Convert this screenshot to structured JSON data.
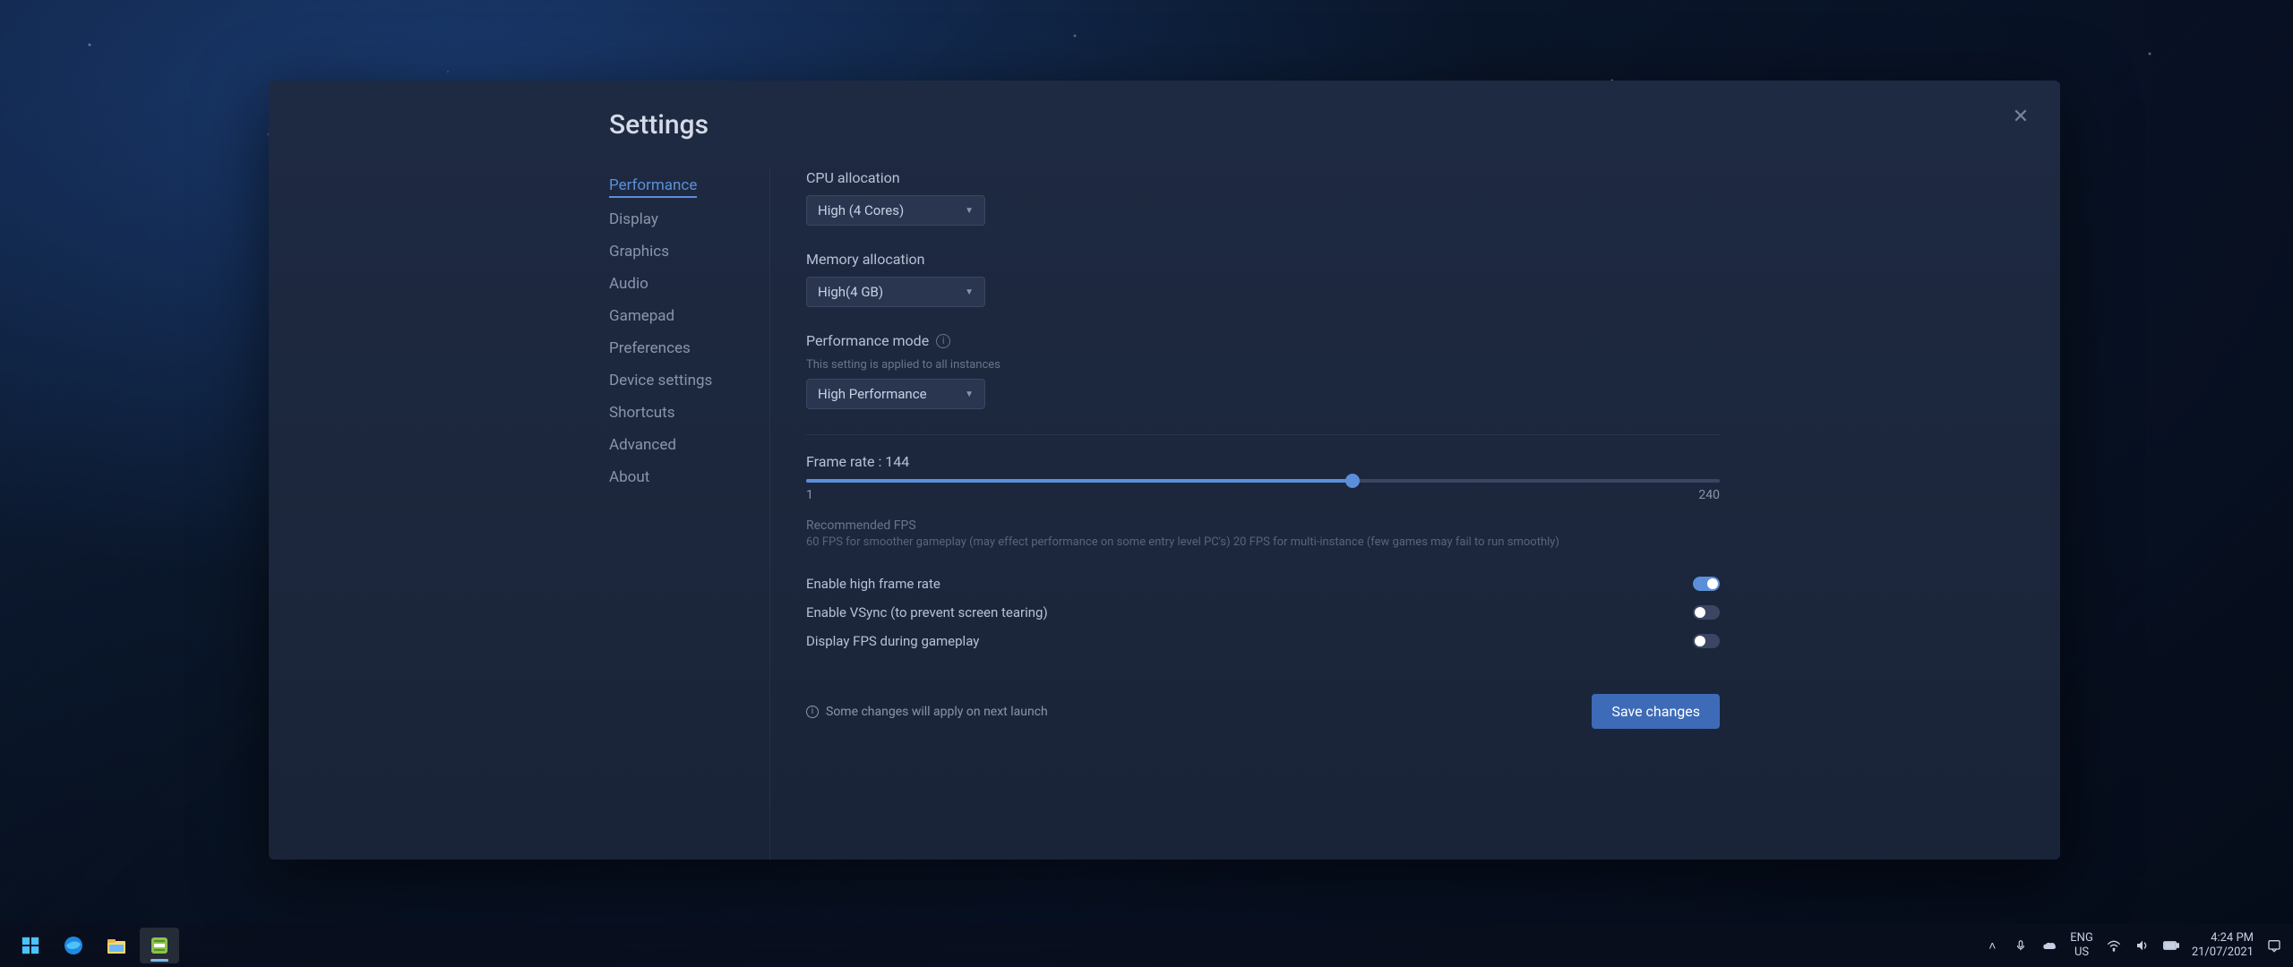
{
  "modal": {
    "title": "Settings",
    "close_label": "✕"
  },
  "sidebar": {
    "items": [
      {
        "label": "Performance",
        "active": true
      },
      {
        "label": "Display",
        "active": false
      },
      {
        "label": "Graphics",
        "active": false
      },
      {
        "label": "Audio",
        "active": false
      },
      {
        "label": "Gamepad",
        "active": false
      },
      {
        "label": "Preferences",
        "active": false
      },
      {
        "label": "Device settings",
        "active": false
      },
      {
        "label": "Shortcuts",
        "active": false
      },
      {
        "label": "Advanced",
        "active": false
      },
      {
        "label": "About",
        "active": false
      }
    ]
  },
  "content": {
    "cpu": {
      "label": "CPU allocation",
      "value": "High (4 Cores)"
    },
    "memory": {
      "label": "Memory allocation",
      "value": "High(4 GB)"
    },
    "perf_mode": {
      "label": "Performance mode",
      "hint": "This setting is applied to all instances",
      "value": "High Performance"
    },
    "frame_rate": {
      "label": "Frame rate : 144",
      "min": "1",
      "max": "240",
      "value": 144
    },
    "recommended": {
      "title": "Recommended FPS",
      "body": "60 FPS for smoother gameplay (may effect performance on some entry level PC's) 20 FPS for multi-instance (few games may fail to run smoothly)"
    },
    "toggles": {
      "high_frame": {
        "label": "Enable high frame rate",
        "on": true
      },
      "vsync": {
        "label": "Enable VSync (to prevent screen tearing)",
        "on": false
      },
      "display_fps": {
        "label": "Display FPS during gameplay",
        "on": false
      }
    },
    "footer_note": "Some changes will apply on next launch",
    "save_label": "Save changes"
  },
  "taskbar": {
    "lang": {
      "line1": "ENG",
      "line2": "US"
    },
    "clock": {
      "time": "4:24 PM",
      "date": "21/07/2021"
    }
  }
}
